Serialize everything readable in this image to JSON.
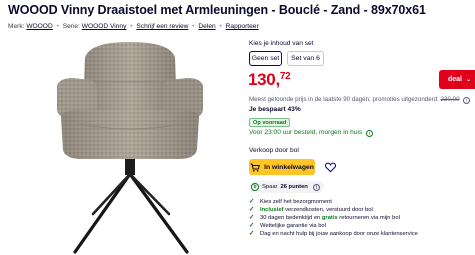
{
  "product": {
    "title": "WOOOD Vinny Draaistoel met Armleuningen - Bouclé - Zand - 89x70x61"
  },
  "meta": {
    "brand_label": "Merk:",
    "brand": "WOOOD",
    "series_label": "Serie:",
    "series": "WOOOD Vinny",
    "review_link": "Schrijf een review",
    "share_link": "Delen",
    "report_link": "Rapporteer"
  },
  "content_choice": {
    "label": "Kies je inhoud van set",
    "options": [
      "Geen set",
      "Set van 6"
    ],
    "selected": "Geen set"
  },
  "price": {
    "euros": "130,",
    "cents": "72",
    "color": "#e0001b"
  },
  "deal_badge": {
    "label": "deal",
    "chevron": "⌄",
    "color": "#e0001b"
  },
  "lowest_price": {
    "text": "Meest getoonde prijs in de laatste 90 dagen, promoties uitgezonderd:",
    "old_price": "230,00",
    "info": "i"
  },
  "saving": {
    "text": "Je bespaart 43%"
  },
  "stock": {
    "badge": "Op voorraad",
    "delivery": "Voor 23:00 uur besteld, morgen in huis",
    "info": "i",
    "color": "#0b7a1f"
  },
  "seller": {
    "text": "Verkoop door bol"
  },
  "actions": {
    "cart_label": "In winkelwagen",
    "cart_icon": "cart-icon",
    "wishlist_icon": "heart-icon",
    "accent": "#ffc426"
  },
  "points": {
    "coin": "b",
    "prefix": "Spaar",
    "value": "26 punten",
    "info": "i"
  },
  "usps": [
    {
      "pre": "",
      "emph": "",
      "post": "Kies zelf het bezorgmoment"
    },
    {
      "pre": "",
      "emph": "Inclusief",
      "post": " verzendkosten, verstuurd door bol"
    },
    {
      "pre": "30 dagen bedenktijd en ",
      "emph": "gratis",
      "post": " retourneren via mijn bol"
    },
    {
      "pre": "",
      "emph": "",
      "post": "Wettelijke garantie via bol"
    },
    {
      "pre": "",
      "emph": "",
      "post": "Dag en nacht hulp bij jouw aankoop door onze klantenservice"
    }
  ]
}
